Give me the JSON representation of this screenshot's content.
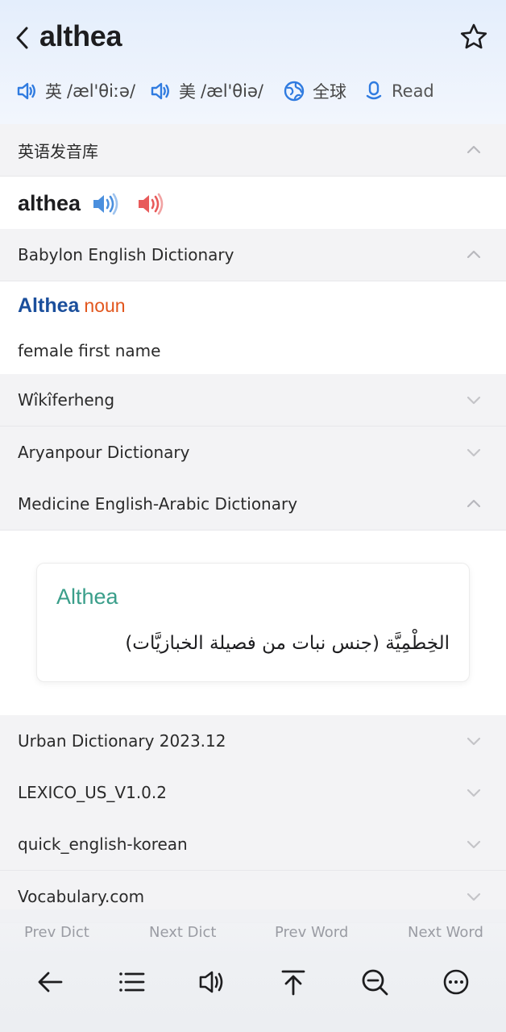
{
  "header": {
    "title": "althea",
    "pronunciations": [
      {
        "region": "英",
        "ipa": "/æl'θiːə/"
      },
      {
        "region": "美",
        "ipa": "/æl'θiə/"
      }
    ],
    "global_label": "全球",
    "read_label": "Read"
  },
  "sections": {
    "voice_library": {
      "title": "英语发音库",
      "word": "althea"
    },
    "babylon": {
      "title": "Babylon English Dictionary",
      "headword": "Althea",
      "pos": "noun",
      "definition": "female first name"
    },
    "wikiferheng": {
      "title": "Wîkîferheng"
    },
    "aryanpour": {
      "title": "Aryanpour Dictionary"
    },
    "medicine": {
      "title": "Medicine English-Arabic Dictionary",
      "headword": "Althea",
      "definition": "الخِطْمِيَّة (جنس نبات من فصيلة الخبازيَّات)"
    },
    "urban": {
      "title": "Urban Dictionary 2023.12"
    },
    "lexico": {
      "title": "LEXICO_US_V1.0.2"
    },
    "quick_korean": {
      "title": "quick_english-korean"
    },
    "vocabulary": {
      "title": "Vocabulary.com"
    }
  },
  "bottom_nav": {
    "prev_dict": "Prev Dict",
    "next_dict": "Next Dict",
    "prev_word": "Prev Word",
    "next_word": "Next Word"
  },
  "toolbar": [
    "back-arrow-icon",
    "list-icon",
    "speaker-icon",
    "scroll-top-icon",
    "search-zoom-icon",
    "more-icon"
  ],
  "colors": {
    "accent": "#2f7be0",
    "babylon_word": "#1b4f9c",
    "noun": "#e2561d",
    "arabic_title": "#3a9e8a",
    "speaker_red": "#e85b5b"
  }
}
